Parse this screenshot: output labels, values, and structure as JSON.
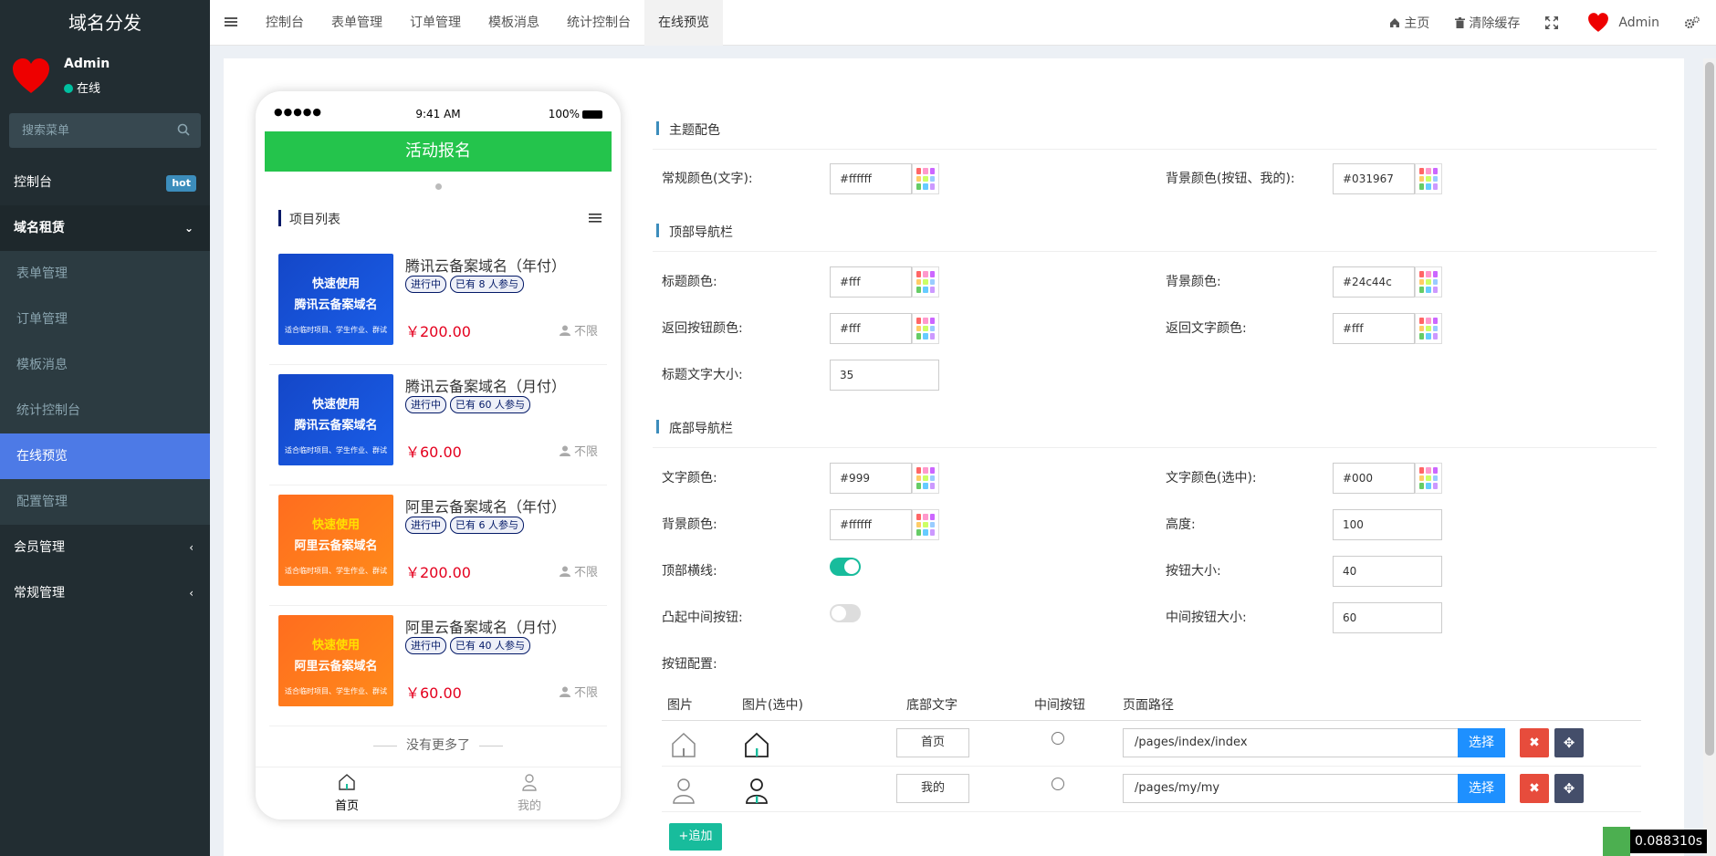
{
  "sidebar": {
    "logo": "域名分发",
    "user": {
      "name": "Admin",
      "status": "在线"
    },
    "search_placeholder": "搜索菜单",
    "items": [
      {
        "label": "控制台",
        "badge": "hot"
      },
      {
        "label": "域名租赁",
        "caret": "⌄"
      },
      {
        "label": "会员管理",
        "caret": "‹"
      },
      {
        "label": "常规管理",
        "caret": "‹"
      }
    ],
    "submenu": [
      "表单管理",
      "订单管理",
      "模板消息",
      "统计控制台",
      "在线预览",
      "配置管理"
    ]
  },
  "topbar": {
    "tabs": [
      "控制台",
      "表单管理",
      "订单管理",
      "模板消息",
      "统计控制台",
      "在线预览"
    ],
    "home": "主页",
    "clear_cache": "清除缓存",
    "admin": "Admin"
  },
  "phone": {
    "signal": "●●●●●",
    "time": "9:41 AM",
    "battery": "100%",
    "banner": "活动报名",
    "list_title": "项目列表",
    "items": [
      {
        "thumb_l1": "快速使用",
        "thumb_l2": "腾讯云备案域名",
        "thumb_l3": "适合临时项目、学生作业、群试",
        "name": "腾讯云备案域名（年付）",
        "status": "进行中",
        "joined": "已有 8 人参与",
        "price": "￥200.00",
        "limit": "不限",
        "color": "#1447c8"
      },
      {
        "thumb_l1": "快速使用",
        "thumb_l2": "腾讯云备案域名",
        "thumb_l3": "适合临时项目、学生作业、群试",
        "name": "腾讯云备案域名（月付）",
        "status": "进行中",
        "joined": "已有 60 人参与",
        "price": "￥60.00",
        "limit": "不限",
        "color": "#1447c8"
      },
      {
        "thumb_l1": "快速使用",
        "thumb_l2": "阿里云备案域名",
        "thumb_l3": "适合临时项目、学生作业、群试",
        "name": "阿里云备案域名（年付）",
        "status": "进行中",
        "joined": "已有 6 人参与",
        "price": "￥200.00",
        "limit": "不限",
        "color": "#ff6d1f"
      },
      {
        "thumb_l1": "快速使用",
        "thumb_l2": "阿里云备案域名",
        "thumb_l3": "适合临时项目、学生作业、群试",
        "name": "阿里云备案域名（月付）",
        "status": "进行中",
        "joined": "已有 40 人参与",
        "price": "￥60.00",
        "limit": "不限",
        "color": "#ff6d1f"
      }
    ],
    "no_more": "没有更多了",
    "nav": [
      {
        "label": "首页"
      },
      {
        "label": "我的"
      }
    ]
  },
  "form": {
    "sections": {
      "theme": "主题配色",
      "top_nav": "顶部导航栏",
      "bottom_nav": "底部导航栏"
    },
    "theme": {
      "text_color_label": "常规颜色(文字):",
      "text_color": "#ffffff",
      "bg_color_label": "背景颜色(按钮、我的):",
      "bg_color": "#031967"
    },
    "top_nav": {
      "title_color_label": "标题颜色:",
      "title_color": "#fff",
      "bg_color_label": "背景颜色:",
      "bg_color": "#24c44c",
      "back_btn_color_label": "返回按钮颜色:",
      "back_btn_color": "#fff",
      "back_text_color_label": "返回文字颜色:",
      "back_text_color": "#fff",
      "title_size_label": "标题文字大小:",
      "title_size": "35"
    },
    "bottom_nav": {
      "text_color_label": "文字颜色:",
      "text_color": "#999",
      "text_sel_color_label": "文字颜色(选中):",
      "text_sel_color": "#000",
      "bg_color_label": "背景颜色:",
      "bg_color": "#ffffff",
      "height_label": "高度:",
      "height": "100",
      "top_line_label": "顶部横线:",
      "top_line": true,
      "btn_size_label": "按钮大小:",
      "btn_size": "40",
      "raised_label": "凸起中间按钮:",
      "raised": false,
      "mid_btn_size_label": "中间按钮大小:",
      "mid_btn_size": "60",
      "btn_config_label": "按钮配置:"
    },
    "table": {
      "headers": [
        "图片",
        "图片(选中)",
        "底部文字",
        "中间按钮",
        "页面路径"
      ],
      "rows": [
        {
          "text": "首页",
          "path": "/pages/index/index",
          "icon": "home-icon"
        },
        {
          "text": "我的",
          "path": "/pages/my/my",
          "icon": "user-icon"
        }
      ],
      "select_label": "选择",
      "delete_label": "✖",
      "move_label": "✥"
    },
    "add_label": "追加"
  },
  "timer": "0.088310s"
}
